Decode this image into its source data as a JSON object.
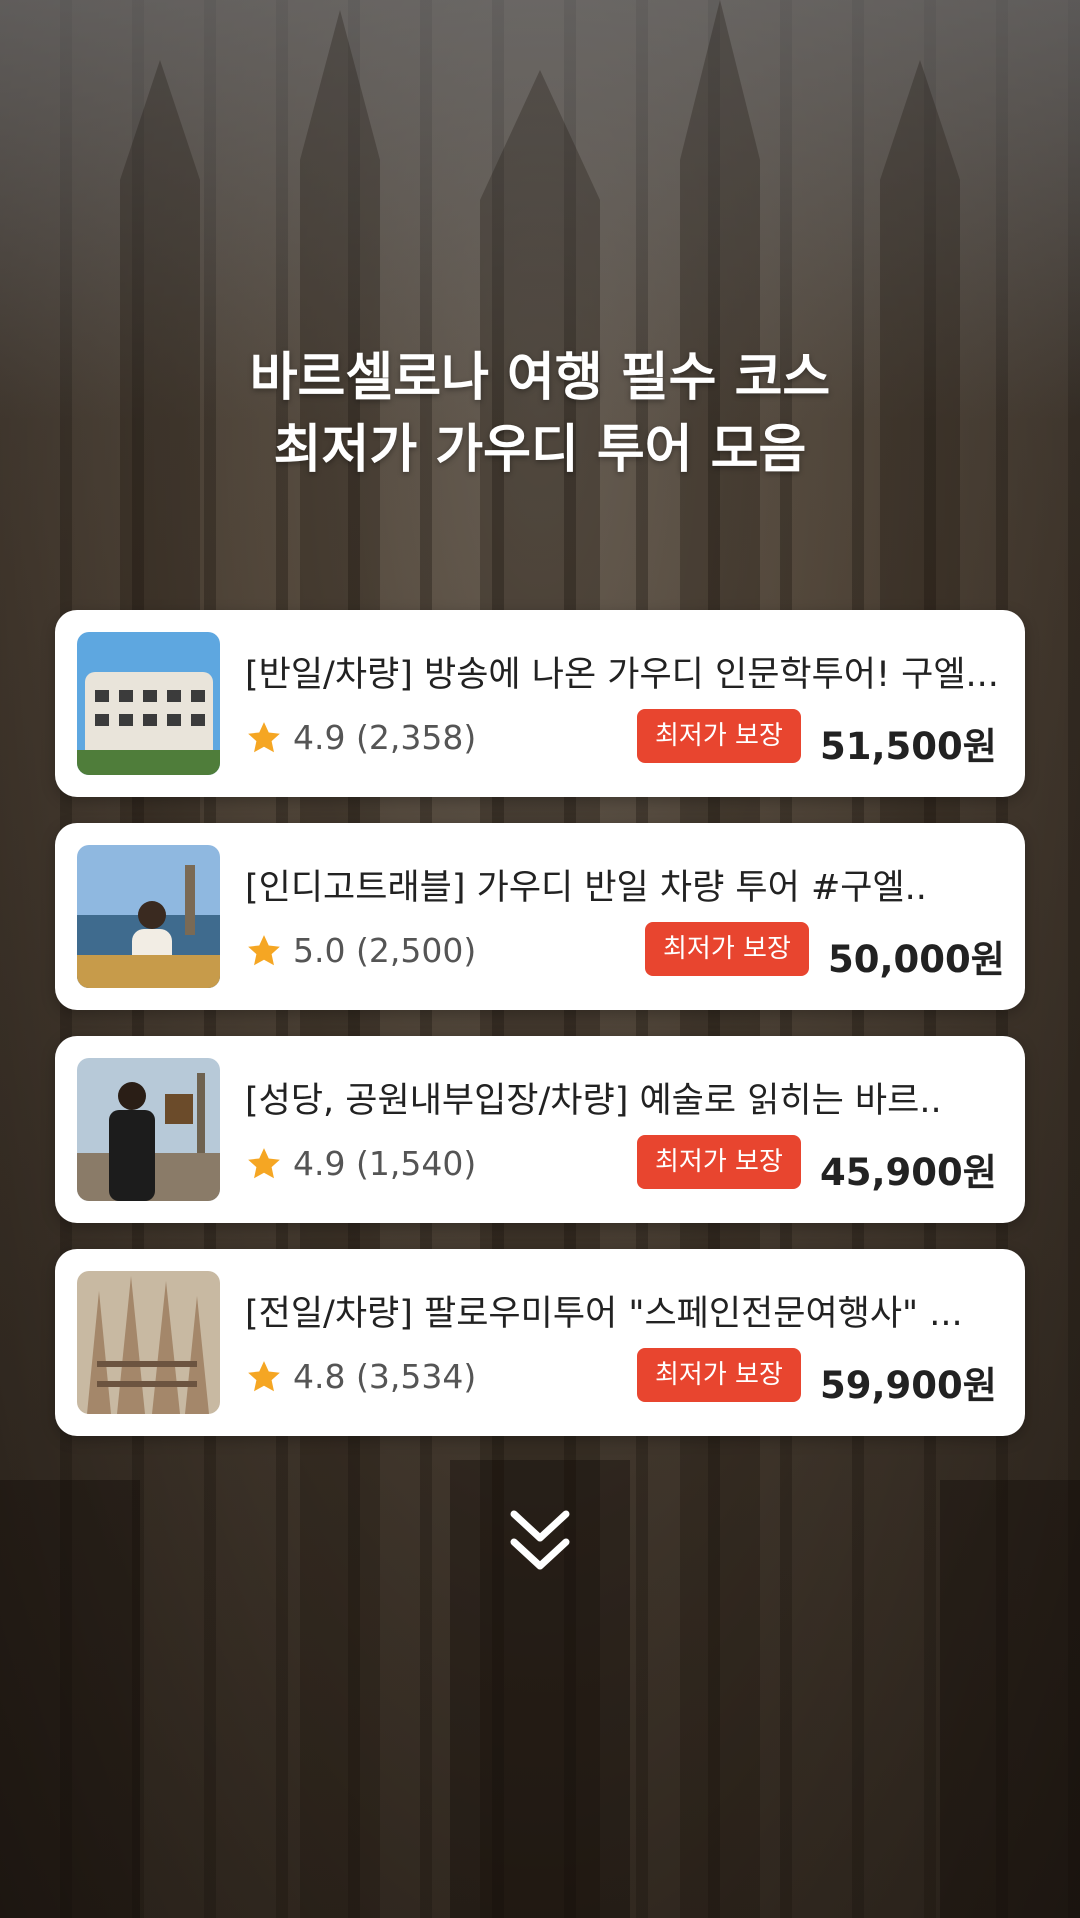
{
  "headline": {
    "line1": "바르셀로나 여행 필수 코스",
    "line2": "최저가 가우디 투어 모음"
  },
  "accent_color": "#e8452f",
  "star_color": "#f5a623",
  "tours": [
    {
      "title": "[반일/차량] 방송에 나온 가우디 인문학투어! 구엘...",
      "rating": "4.9",
      "reviews": "(2,358)",
      "badge": "최저가 보장",
      "price": "51,500원"
    },
    {
      "title": "[인디고트래블] 가우디 반일 차량 투어 #구엘..",
      "rating": "5.0",
      "reviews": "(2,500)",
      "badge": "최저가 보장",
      "price": "50,000원"
    },
    {
      "title": "[성당, 공원내부입장/차량] 예술로 읽히는 바르..",
      "rating": "4.9",
      "reviews": "(1,540)",
      "badge": "최저가 보장",
      "price": "45,900원"
    },
    {
      "title": "[전일/차량] 팔로우미투어 \"스페인전문여행사\" ...",
      "rating": "4.8",
      "reviews": "(3,534)",
      "badge": "최저가 보장",
      "price": "59,900원"
    }
  ],
  "scroll_icon": "double-chevron-down-icon"
}
